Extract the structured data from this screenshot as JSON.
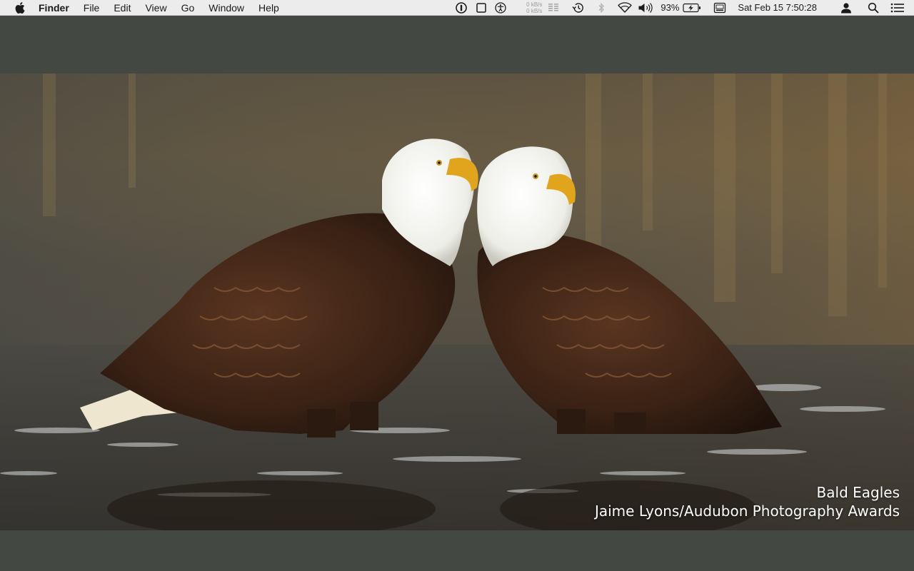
{
  "menubar": {
    "apple_icon": "apple-logo-icon",
    "app_name": "Finder",
    "menus": [
      "File",
      "Edit",
      "View",
      "Go",
      "Window",
      "Help"
    ],
    "status": {
      "net_up": "0 kB/s",
      "net_down": "0 kB/s",
      "battery_percent": "93%",
      "datetime": "Sat Feb 15  7:50:28"
    },
    "icons": [
      "password-manager-icon",
      "window-icon",
      "accessibility-icon",
      "network-speed-icon",
      "memory-bars-icon",
      "time-machine-icon",
      "bluetooth-icon",
      "wifi-icon",
      "volume-icon",
      "battery-charging-icon",
      "keyboard-input-icon",
      "user-icon",
      "search-icon",
      "notification-center-icon"
    ]
  },
  "wallpaper": {
    "title": "Bald Eagles",
    "credit": "Jaime Lyons/Audubon Photography Awards"
  },
  "colors": {
    "desktop": "#434842",
    "menubar": "#ececec"
  }
}
